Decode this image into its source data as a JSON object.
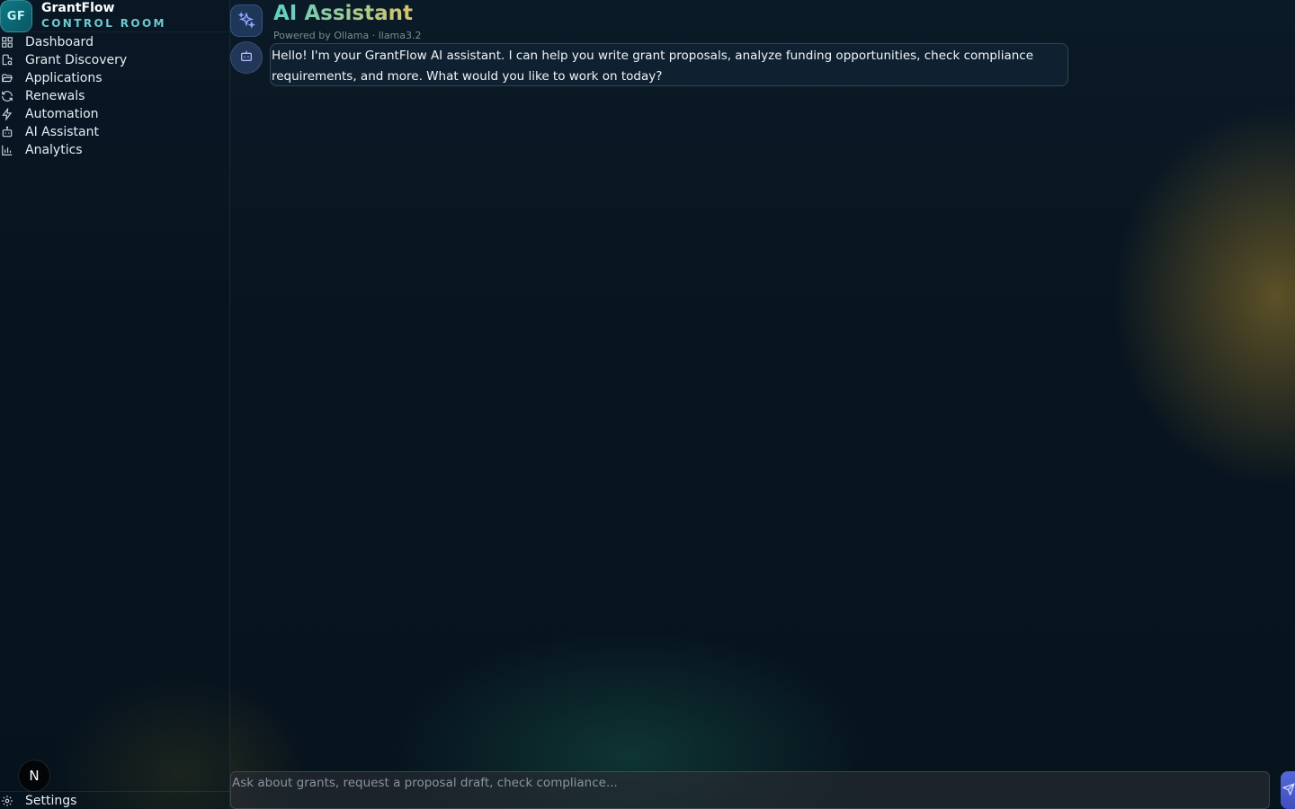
{
  "brand": {
    "logo_text": "GF",
    "name": "GrantFlow",
    "subtitle": "CONTROL ROOM"
  },
  "sidebar": {
    "items": [
      {
        "label": "Dashboard",
        "icon": "grid-icon"
      },
      {
        "label": "Grant Discovery",
        "icon": "file-search-icon"
      },
      {
        "label": "Applications",
        "icon": "folder-open-icon"
      },
      {
        "label": "Renewals",
        "icon": "refresh-icon"
      },
      {
        "label": "Automation",
        "icon": "zap-icon"
      },
      {
        "label": "AI Assistant",
        "icon": "bot-icon"
      },
      {
        "label": "Analytics",
        "icon": "bar-chart-icon"
      }
    ],
    "settings_label": "Settings",
    "user_initial": "N"
  },
  "header": {
    "title": "AI Assistant",
    "subtitle": "Powered by Ollama · llama3.2"
  },
  "chat": {
    "messages": [
      {
        "role": "assistant",
        "text": "Hello! I'm your GrantFlow AI assistant. I can help you write grant proposals, analyze funding opportunities, check compliance requirements, and more. What would you like to work on today?"
      }
    ]
  },
  "composer": {
    "placeholder": "Ask about grants, request a proposal draft, check compliance...",
    "value": ""
  },
  "colors": {
    "accent": "#5fd0c4",
    "gold": "#d9c46a",
    "send": "#4f62d6"
  }
}
